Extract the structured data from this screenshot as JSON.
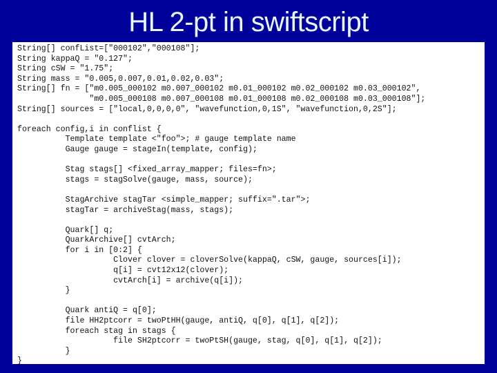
{
  "slide": {
    "title": "HL 2-pt in swiftscript",
    "colors": {
      "background": "#00009a",
      "title": "#e8f4ff",
      "panel": "#ffffff",
      "code_text": "#111111"
    }
  },
  "code": {
    "lines": [
      "String[] confList=[\"000102\",\"000108\"];",
      "String kappaQ = \"0.127\";",
      "String cSW = \"1.75\";",
      "String mass = \"0.005,0.007,0.01,0.02,0.03\";",
      "String[] fn = [\"m0.005_000102 m0.007_000102 m0.01_000102 m0.02_000102 m0.03_000102\",",
      "               \"m0.005_000108 m0.007_000108 m0.01_000108 m0.02_000108 m0.03_000108\"];",
      "String[] sources = [\"local,0,0,0,0\", \"wavefunction,0,1S\", \"wavefunction,0,2S\"];",
      "",
      "foreach config,i in conflist {",
      "          Template template <\"foo\">; # gauge template name",
      "          Gauge gauge = stageIn(template, config);",
      "",
      "          Stag stags[] <fixed_array_mapper; files=fn>;",
      "          stags = stagSolve(gauge, mass, source);",
      "",
      "          StagArchive stagTar <simple_mapper; suffix=\".tar\">;",
      "          stagTar = archiveStag(mass, stags);",
      "",
      "          Quark[] q;",
      "          QuarkArchive[] cvtArch;",
      "          for i in [0:2] {",
      "                    Clover clover = cloverSolve(kappaQ, cSW, gauge, sources[i]);",
      "                    q[i] = cvt12x12(clover);",
      "                    cvtArch[i] = archive(q[i]);",
      "          }",
      "",
      "          Quark antiQ = q[0];",
      "          file HH2ptcorr = twoPtHH(gauge, antiQ, q[0], q[1], q[2]);",
      "          foreach stag in stags {",
      "                    file SH2ptcorr = twoPtSH(gauge, stag, q[0], q[1], q[2]);",
      "          }",
      "}"
    ]
  }
}
